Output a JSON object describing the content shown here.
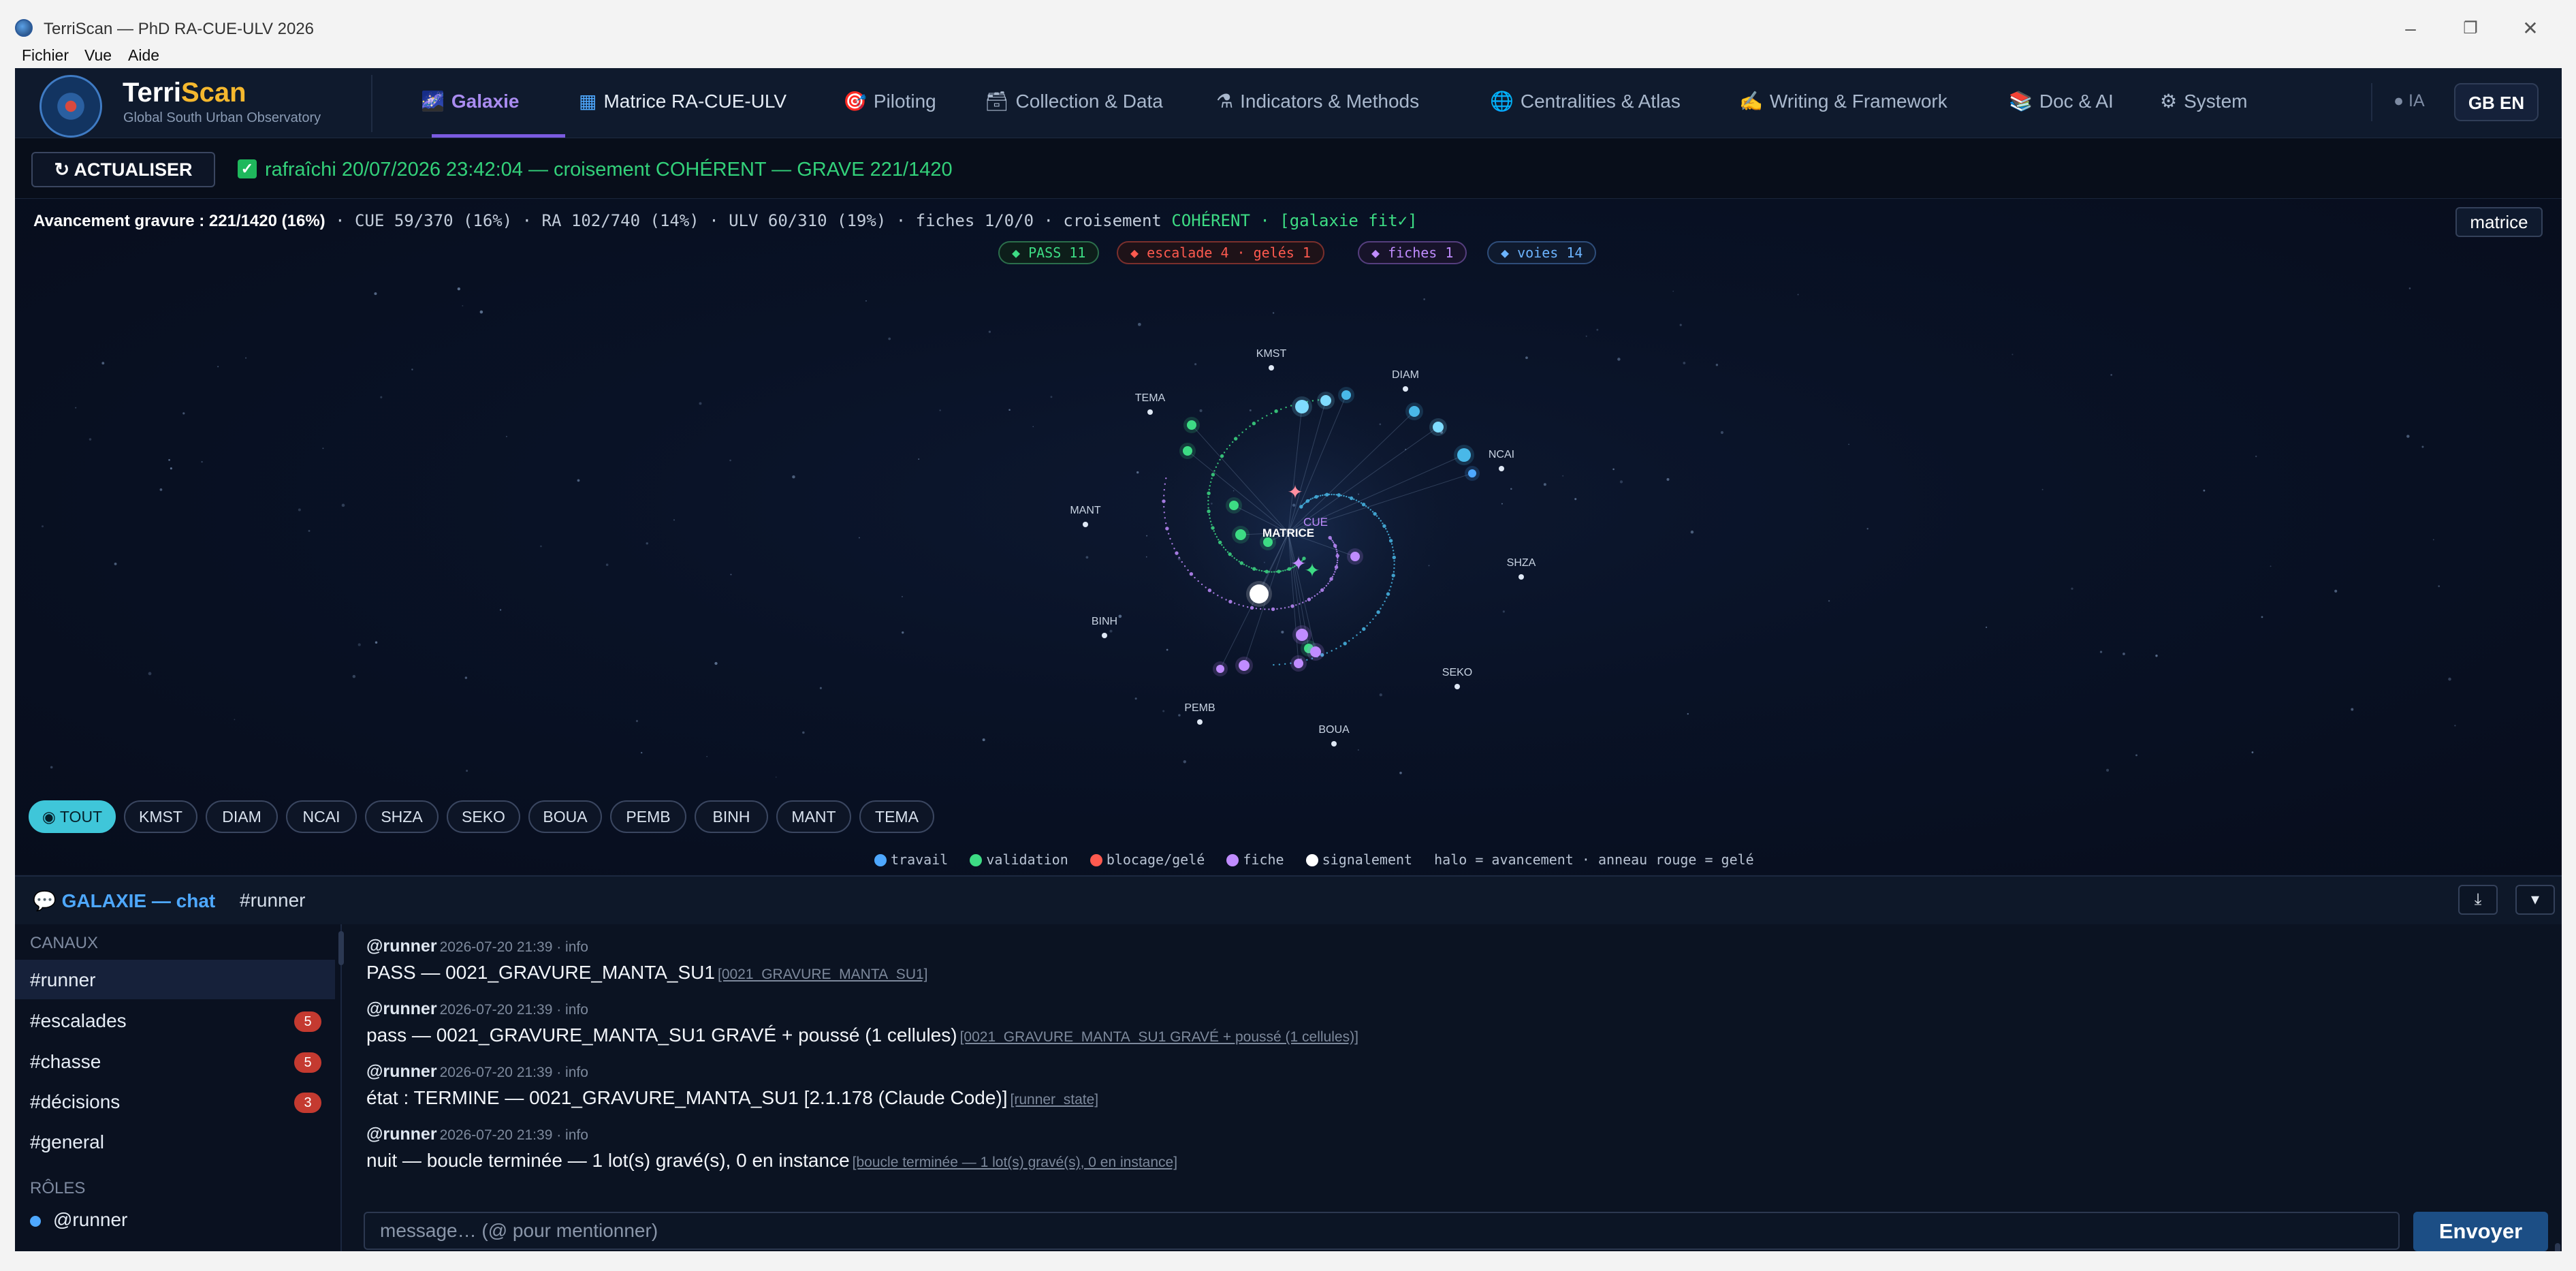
{
  "window": {
    "title": "TerriScan — PhD RA-CUE-ULV 2026",
    "minimize": "–",
    "restore": "❐",
    "close": "✕"
  },
  "menu": [
    "Fichier",
    "Vue",
    "Aide"
  ],
  "brand": {
    "name_a": "Terri",
    "name_b": "Scan",
    "tagline": "Global South Urban Observatory"
  },
  "nav": {
    "tabs": [
      {
        "icon": "🌌",
        "label": "Galaxie",
        "active": true
      },
      {
        "icon": "▦",
        "label": "Matrice RA-CUE-ULV"
      },
      {
        "icon": "🎯",
        "label": "Piloting"
      },
      {
        "icon": "🗃",
        "label": "Collection & Data"
      },
      {
        "icon": "⚗",
        "label": "Indicators & Methods"
      },
      {
        "icon": "🌐",
        "label": "Centralities & Atlas"
      },
      {
        "icon": "✍",
        "label": "Writing & Framework"
      },
      {
        "icon": "📚",
        "label": "Doc & AI"
      },
      {
        "icon": "⚙",
        "label": "System"
      }
    ],
    "ia_toggle": "● IA",
    "language": "GB EN"
  },
  "toolbar": {
    "refresh_label": "↻ ACTUALISER",
    "status": "rafraîchi 20/07/2026 23:42:04 — croisement COHÉRENT — GRAVE 221/1420"
  },
  "galaxy": {
    "progress_bold": "Avancement gravure : 221/1420 (16%)",
    "progress_rest": " · CUE 59/370 (16%) · RA 102/740 (14%) · ULV 60/310 (19%) · fiches 1/0/0 · croisement ",
    "progress_ok": "COHÉRENT · [galaxie fit✓]",
    "matrice_button": "matrice",
    "pills": [
      {
        "label": "◆ PASS 11",
        "color": "#3ddc84"
      },
      {
        "label": "◆ escalade 4 · gelés 1",
        "color": "#ff5a4f"
      },
      {
        "label": "◆ fiches 1",
        "color": "#c08cff"
      },
      {
        "label": "◆ voies 14",
        "color": "#6cb4ff"
      }
    ],
    "center_labels": [
      "MATRICE",
      "CUE"
    ],
    "nodes": [
      "KMST",
      "DIAM",
      "TEMA",
      "NCAI",
      "MANT",
      "SHZA",
      "BINH",
      "SEKO",
      "PEMB",
      "BOUA"
    ],
    "filters": [
      "◉ TOUT",
      "KMST",
      "DIAM",
      "NCAI",
      "SHZA",
      "SEKO",
      "BOUA",
      "PEMB",
      "BINH",
      "MANT",
      "TEMA"
    ],
    "legend": [
      {
        "label": "travail",
        "color": "#4ea8ff"
      },
      {
        "label": "validation",
        "color": "#3ddc84"
      },
      {
        "label": "blocage/gelé",
        "color": "#ff5a4f"
      },
      {
        "label": "fiche",
        "color": "#c08cff"
      },
      {
        "label": "signalement",
        "color": "#ffffff"
      }
    ],
    "legend_note": "halo = avancement · anneau rouge = gelé"
  },
  "chat": {
    "title": "💬 GALAXIE — chat",
    "channel": "#runner",
    "download_icon": "⤓",
    "collapse_icon": "▾",
    "channels_label": "CANAUX",
    "channels": [
      {
        "name": "#runner",
        "badge": "",
        "active": true
      },
      {
        "name": "#escalades",
        "badge": "5"
      },
      {
        "name": "#chasse",
        "badge": "5"
      },
      {
        "name": "#décisions",
        "badge": "3"
      },
      {
        "name": "#general",
        "badge": ""
      }
    ],
    "roles_label": "RÔLES",
    "roles": [
      "@runner"
    ],
    "messages": [
      {
        "author": "@runner",
        "meta": "2026-07-20 21:39 · info",
        "body": "PASS — 0021_GRAVURE_MANTA_SU1",
        "ref": "[0021_GRAVURE_MANTA_SU1]"
      },
      {
        "author": "@runner",
        "meta": "2026-07-20 21:39 · info",
        "body": "pass — 0021_GRAVURE_MANTA_SU1 GRAVÉ + poussé (1 cellules)",
        "ref": "[0021_GRAVURE_MANTA_SU1 GRAVÉ + poussé (1 cellules)]"
      },
      {
        "author": "@runner",
        "meta": "2026-07-20 21:39 · info",
        "body": "état : TERMINE — 0021_GRAVURE_MANTA_SU1 [2.1.178 (Claude Code)]",
        "ref": "[runner_state]"
      },
      {
        "author": "@runner",
        "meta": "2026-07-20 21:39 · info",
        "body": "nuit — boucle terminée — 1 lot(s) gravé(s), 0 en instance",
        "ref": "[boucle terminée — 1 lot(s) gravé(s), 0 en instance]"
      }
    ],
    "input_placeholder": "message… (@ pour mentionner)",
    "send_label": "Envoyer"
  }
}
